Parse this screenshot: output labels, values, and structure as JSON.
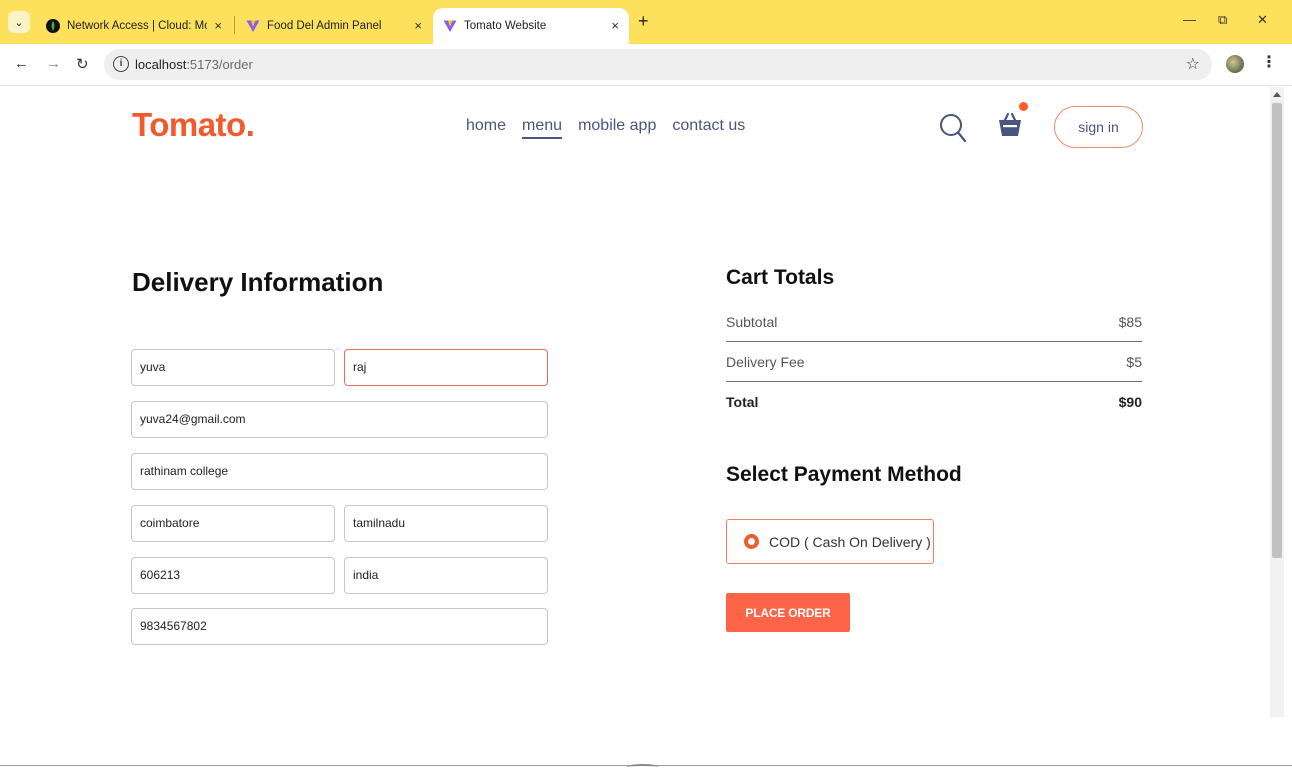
{
  "browser": {
    "tabs": [
      {
        "title": "Network Access | Cloud: Mongo",
        "active": false
      },
      {
        "title": "Food Del Admin Panel",
        "active": false
      },
      {
        "title": "Tomato Website",
        "active": true
      }
    ],
    "tab_close_glyph": "×",
    "new_tab_glyph": "+",
    "url_host": "localhost",
    "url_path": ":5173/order",
    "window_controls": {
      "minimize": "—",
      "restore": "⧉",
      "close": "✕"
    }
  },
  "site": {
    "logo": "Tomato.",
    "nav": [
      "home",
      "menu",
      "mobile app",
      "contact us"
    ],
    "active_nav": "menu",
    "signin_label": "sign in",
    "accent": "#f05a2c",
    "nav_color": "#49557e"
  },
  "delivery": {
    "title": "Delivery Information",
    "first_name": "yuva",
    "last_name": "raj",
    "email": "yuva24@gmail.com",
    "street": "rathinam college",
    "city": "coimbatore",
    "state": "tamilnadu",
    "zip": "606213",
    "country": "india",
    "phone": "9834567802"
  },
  "cart": {
    "title": "Cart Totals",
    "rows": [
      {
        "label": "Subtotal",
        "value": "$85"
      },
      {
        "label": "Delivery Fee",
        "value": "$5"
      },
      {
        "label": "Total",
        "value": "$90"
      }
    ]
  },
  "payment": {
    "title": "Select Payment Method",
    "option": "COD ( Cash On Delivery )",
    "button": "PLACE ORDER",
    "button_color": "#fe6447"
  }
}
